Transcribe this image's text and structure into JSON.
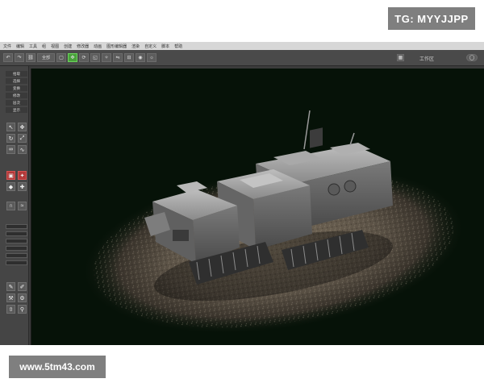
{
  "watermark": {
    "tag": "TG: MYYJJPP",
    "site": "www.5tm43.com"
  },
  "app": {
    "menu_items": [
      "文件",
      "编辑",
      "工具",
      "组",
      "视图",
      "创建",
      "修改器",
      "动画",
      "图形编辑器",
      "渲染",
      "自定义",
      "脚本",
      "帮助"
    ],
    "toolbar_left_label": "全部",
    "toolbar_right_label": "工作区",
    "left_panel": {
      "labels": [
        "拾取",
        "选择",
        "变换",
        "修改",
        "层次",
        "显示"
      ],
      "icon_names": [
        "select-icon",
        "move-icon",
        "rotate-icon",
        "scale-icon",
        "link-icon",
        "camera-icon",
        "light-icon",
        "shape-icon",
        "helper-icon",
        "magnet-icon"
      ]
    },
    "viewport": {
      "label": "[+] [透视] [真实]",
      "model": "sci-fi tank vehicle on gravel terrain"
    },
    "colors": {
      "viewport_bg": "#061208",
      "active_tool": "#49a13b",
      "panel_bg": "#454545"
    }
  }
}
